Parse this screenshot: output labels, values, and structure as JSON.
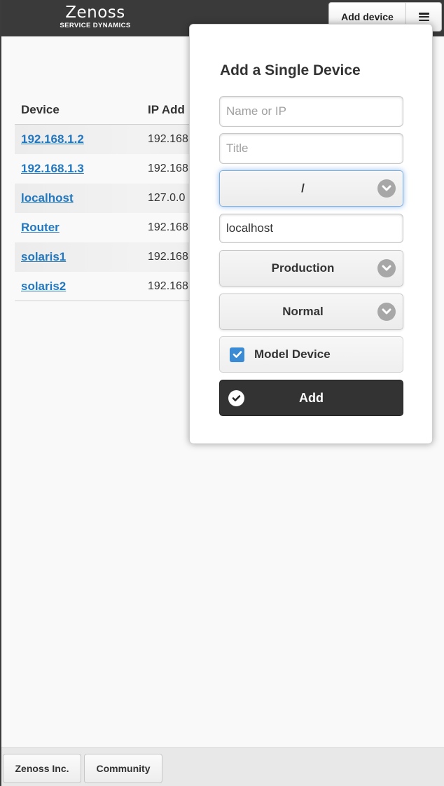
{
  "header": {
    "logo_text": "Zenoss",
    "logo_subtitle": "SERVICE DYNAMICS",
    "add_device_label": "Add device",
    "menu_icon": "hamburger-menu-icon"
  },
  "table": {
    "columns": [
      "Device",
      "IP Add"
    ],
    "rows": [
      {
        "name": "192.168.1.2",
        "ip": "192.168"
      },
      {
        "name": "192.168.1.3",
        "ip": "192.168"
      },
      {
        "name": "localhost",
        "ip": "127.0.0"
      },
      {
        "name": "Router",
        "ip": "192.168"
      },
      {
        "name": "solaris1",
        "ip": "192.168"
      },
      {
        "name": "solaris2",
        "ip": "192.168"
      }
    ]
  },
  "popup": {
    "title": "Add a Single Device",
    "name_placeholder": "Name or IP",
    "name_value": "",
    "title_placeholder": "Title",
    "title_value": "",
    "device_class_value": "/",
    "collector_value": "localhost",
    "production_state_value": "Production",
    "priority_value": "Normal",
    "model_device_label": "Model Device",
    "model_device_checked": true,
    "add_button_label": "Add"
  },
  "footer": {
    "buttons": [
      "Zenoss Inc.",
      "Community"
    ]
  },
  "colors": {
    "header_bg": "#3a3a3a",
    "link": "#2378c0",
    "checkbox": "#3a8ad4",
    "add_button_bg": "#333333",
    "focus_glow": "#3882db"
  }
}
